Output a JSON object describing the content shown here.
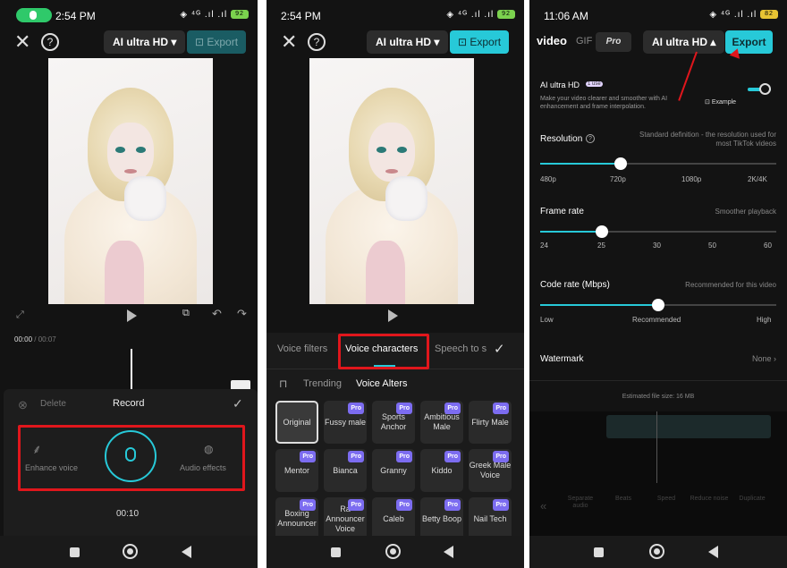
{
  "p1": {
    "status_time": "2:54 PM",
    "status_icons": "◈ ⁴ᴳ .ıl .ıl",
    "battery": "92",
    "resolution": "AI ultra HD",
    "export": "Export",
    "timecode": "00:00",
    "timecode_total": "/ 00:07",
    "delete": "Delete",
    "record": "Record",
    "enhance_voice": "Enhance voice",
    "audio_effects": "Audio effects",
    "rec_time": "00:10"
  },
  "p2": {
    "status_time": "2:54 PM",
    "status_icons": "◈ ⁴ᴳ .ıl .ıl",
    "battery": "92",
    "resolution": "AI ultra HD",
    "export": "Export",
    "tabs": [
      "Voice filters",
      "Voice characters",
      "Speech to s"
    ],
    "subtabs": [
      "Trending",
      "Voice Alters"
    ],
    "pro_badge": "Pro",
    "voices": [
      {
        "name": "Original",
        "pro": false
      },
      {
        "name": "Fussy male",
        "pro": true
      },
      {
        "name": "Sports Anchor",
        "pro": true
      },
      {
        "name": "Ambitious Male",
        "pro": true
      },
      {
        "name": "Flirty Male",
        "pro": true
      },
      {
        "name": "Mentor",
        "pro": true
      },
      {
        "name": "Bianca",
        "pro": true
      },
      {
        "name": "Granny",
        "pro": true
      },
      {
        "name": "Kiddo",
        "pro": true
      },
      {
        "name": "Greek Male Voice",
        "pro": true
      },
      {
        "name": "Boxing Announcer",
        "pro": true
      },
      {
        "name": "Ra Announcer Voice",
        "pro": true
      },
      {
        "name": "Caleb",
        "pro": true
      },
      {
        "name": "Betty Boop",
        "pro": true
      },
      {
        "name": "Nail Tech",
        "pro": true
      }
    ]
  },
  "p3": {
    "status_time": "11:06 AM",
    "status_icons": "◈ ⁴ᴳ .ıl .ıl",
    "battery": "82",
    "tab_video": "video",
    "tab_gif": "GIF",
    "tab_pro": "Pro",
    "resolution": "AI ultra HD",
    "export": "Export",
    "ai_title": "AI ultra HD",
    "ai_badge": "1 use",
    "ai_desc": "Make your video clearer and smoother with AI enhancement and frame interpolation.",
    "example": "Example",
    "resolution_title": "Resolution",
    "resolution_sub": "Standard definition - the resolution used for most TikTok videos",
    "resolution_ticks": [
      "480p",
      "720p",
      "1080p",
      "2K/4K"
    ],
    "resolution_selected": "720p",
    "framerate_title": "Frame rate",
    "framerate_sub": "Smoother playback",
    "framerate_ticks": [
      "24",
      "25",
      "30",
      "50",
      "60"
    ],
    "framerate_selected": "25",
    "coderate_title": "Code rate (Mbps)",
    "coderate_sub": "Recommended for this video",
    "coderate_ticks": [
      "Low",
      "Recommended",
      "High"
    ],
    "coderate_selected": "Recommended",
    "watermark_title": "Watermark",
    "watermark_value": "None",
    "file_size": "Estimated file size: 16 MB",
    "bottom_tools": [
      "Separate audio",
      "Beats",
      "Speed",
      "Reduce noise",
      "Duplicate"
    ]
  },
  "colors": {
    "accent": "#27c9d8",
    "highlight": "#e0161c",
    "pro": "#7c6cf0"
  }
}
